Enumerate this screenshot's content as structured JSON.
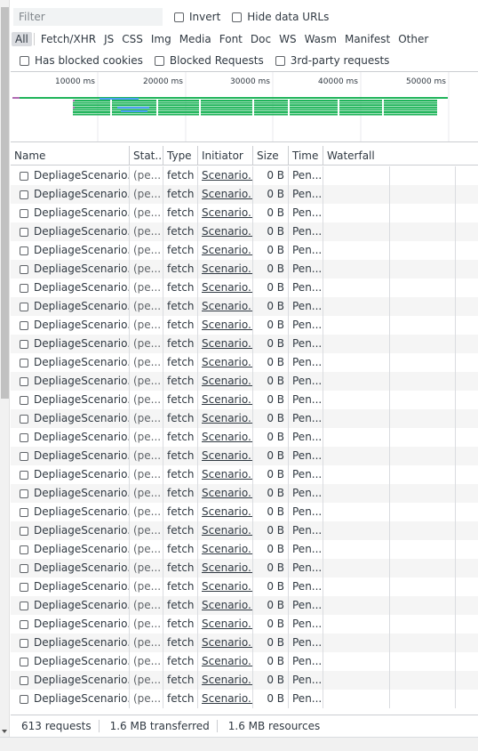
{
  "filter": {
    "placeholder": "Filter",
    "invert_label": "Invert",
    "hide_data_urls_label": "Hide data URLs"
  },
  "types": [
    "All",
    "Fetch/XHR",
    "JS",
    "CSS",
    "Img",
    "Media",
    "Font",
    "Doc",
    "WS",
    "Wasm",
    "Manifest",
    "Other"
  ],
  "blocked_options": [
    "Has blocked cookies",
    "Blocked Requests",
    "3rd-party requests"
  ],
  "overview": {
    "ticks": [
      "10000 ms",
      "20000 ms",
      "30000 ms",
      "40000 ms",
      "50000 ms"
    ]
  },
  "table": {
    "headers": {
      "name": "Name",
      "status": "Stat..",
      "type": "Type",
      "initiator": "Initiator",
      "size": "Size",
      "time": "Time",
      "waterfall": "Waterfall"
    },
    "row_template": {
      "name": "DepliageScenario...",
      "status": "(pe...",
      "type": "fetch",
      "initiator": "Scenario...",
      "size": "0 B",
      "time": "Pen..."
    },
    "visible_rows": 29
  },
  "status": {
    "requests": "613 requests",
    "transferred": "1.6 MB transferred",
    "resources": "1.6 MB resources"
  },
  "colors": {
    "bar_green": "#1fb45a",
    "bar_blue": "#4e9ff5",
    "selected_type_bg": "#dadce0"
  }
}
